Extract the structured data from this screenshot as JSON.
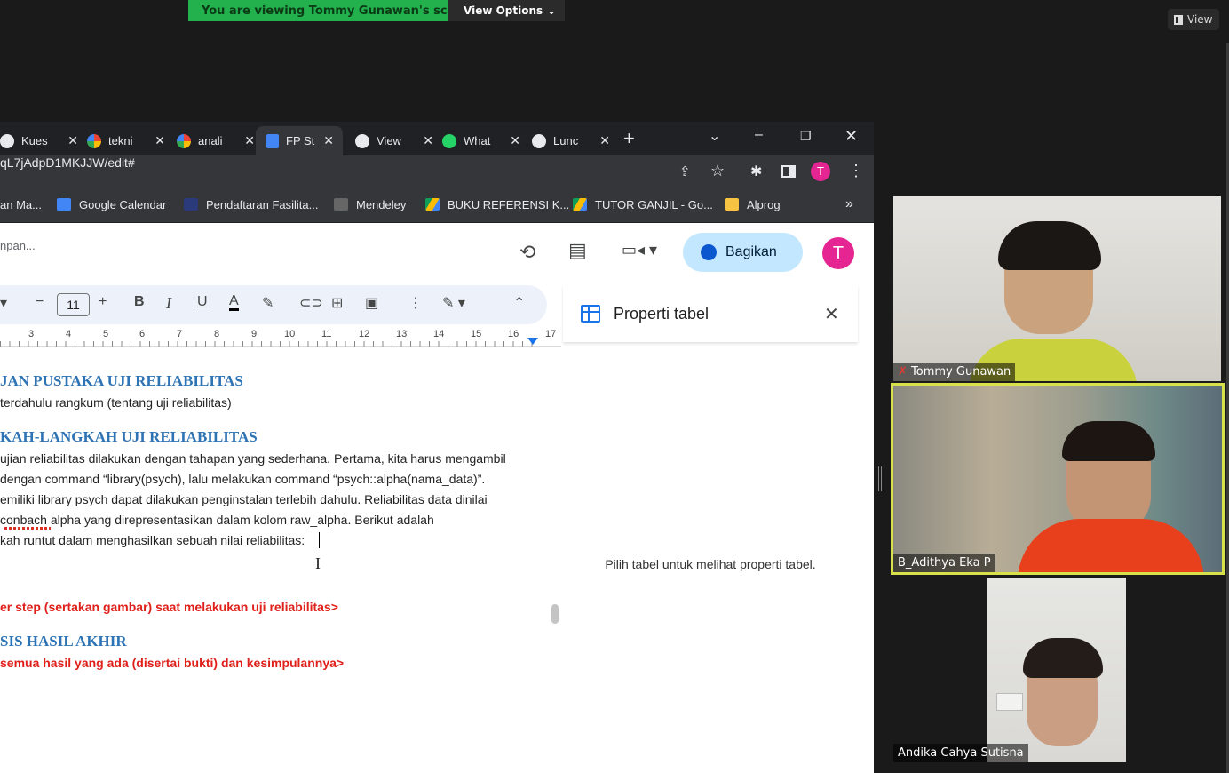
{
  "zoom": {
    "banner_text": "You are viewing Tommy Gunawan's screen",
    "view_options_label": "View Options",
    "view_button_label": "View"
  },
  "browser": {
    "tabs": [
      {
        "label": "Kues",
        "favicon": "globe-icon"
      },
      {
        "label": "tekni",
        "favicon": "google-icon"
      },
      {
        "label": "anali",
        "favicon": "google-icon"
      },
      {
        "label": "FP St",
        "favicon": "docs-icon"
      },
      {
        "label": "View",
        "favicon": "globe-icon"
      },
      {
        "label": "What",
        "favicon": "whatsapp-icon"
      },
      {
        "label": "Lunc",
        "favicon": "globe-icon"
      }
    ],
    "url": "qL7jAdpD1MKJJW/edit#",
    "profile_initial": "T",
    "bookmarks": [
      {
        "label": "an Ma..."
      },
      {
        "label": "Google Calendar"
      },
      {
        "label": "Pendaftaran Fasilita..."
      },
      {
        "label": "Mendeley"
      },
      {
        "label": "BUKU REFERENSI K..."
      },
      {
        "label": "TUTOR GANJIL - Go..."
      },
      {
        "label": "Alprog"
      }
    ]
  },
  "docs": {
    "saving_status": "npan...",
    "share_label": "Bagikan",
    "avatar_initial": "T",
    "font_size": "11",
    "ruler_numbers": [
      "3",
      "4",
      "5",
      "6",
      "7",
      "8",
      "9",
      "10",
      "11",
      "12",
      "13",
      "14",
      "15",
      "16",
      "17"
    ],
    "content": {
      "heading1": "JAN PUSTAKA UJI RELIABILITAS",
      "line1": "terdahulu rangkum (tentang uji reliabilitas)",
      "heading2": "KAH-LANGKAH UJI RELIABILITAS",
      "para_lines": [
        "ujian reliabilitas dilakukan dengan tahapan yang sederhana. Pertama, kita harus mengambil",
        "dengan command “library(psych), lalu melakukan command “psych::alpha(nama_data)”.",
        "emiliki library psych dapat dilakukan penginstalan terlebih dahulu. Reliabilitas data dinilai",
        " conbach alpha yang direpresentasikan dalam kolom raw_alpha. Berikut adalah",
        "kah runtut dalam menghasilkan sebuah nilai reliabilitas:"
      ],
      "red1": "er step (sertakan gambar) saat melakukan uji reliabilitas>",
      "heading3": "SIS HASIL AKHIR",
      "red2": "semua hasil yang ada (disertai bukti) dan kesimpulannya>"
    },
    "side_panel": {
      "title": "Properti tabel",
      "message": "Pilih tabel untuk melihat properti tabel."
    }
  },
  "participants": [
    {
      "name": "Tommy Gunawan",
      "muted": true
    },
    {
      "name": "B_Adithya Eka P",
      "active_speaker": true
    },
    {
      "name": "Andika Cahya Sutisna"
    }
  ],
  "colors": {
    "zoom_green": "#22b14c",
    "share_blue": "#c2e7ff",
    "heading_blue": "#2e74b5",
    "todo_red": "#e0201b",
    "active_speaker_border": "#d8e04a"
  }
}
